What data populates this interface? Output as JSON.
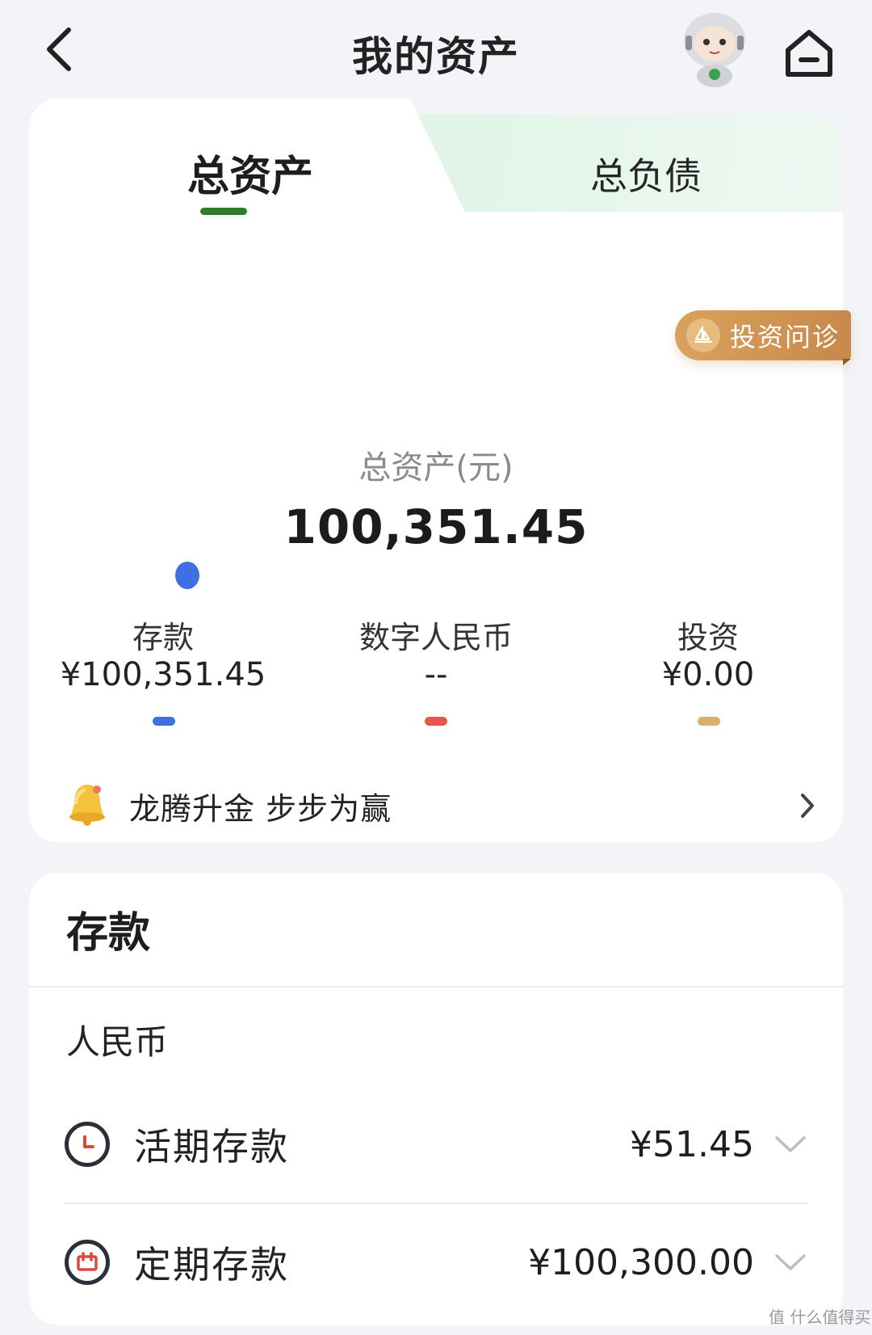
{
  "header": {
    "title": "我的资产",
    "back_icon": "chevron-left-icon",
    "assistant_icon": "robot-assistant-icon",
    "home_icon": "home-icon"
  },
  "tabs": [
    {
      "label": "总资产",
      "active": true
    },
    {
      "label": "总负债",
      "active": false
    }
  ],
  "invest_badge": {
    "label": "投资问诊",
    "icon": "sailboat-icon"
  },
  "summary": {
    "label": "总资产(元)",
    "value": "100,351.45"
  },
  "categories": [
    {
      "name": "存款",
      "value": "¥100,351.45",
      "color": "#3f6fe0"
    },
    {
      "name": "数字人民币",
      "value": "--",
      "color": "#e5574a"
    },
    {
      "name": "投资",
      "value": "¥0.00",
      "color": "#dcae6b"
    }
  ],
  "promo": {
    "text": "龙腾升金 步步为赢",
    "icon": "bell-icon"
  },
  "deposit": {
    "title": "存款",
    "currency": "人民币",
    "rows": [
      {
        "label": "活期存款",
        "amount": "¥51.45",
        "icon": "clock-icon"
      },
      {
        "label": "定期存款",
        "amount": "¥100,300.00",
        "icon": "calendar-icon"
      }
    ]
  },
  "watermark": "值 什么值得买"
}
